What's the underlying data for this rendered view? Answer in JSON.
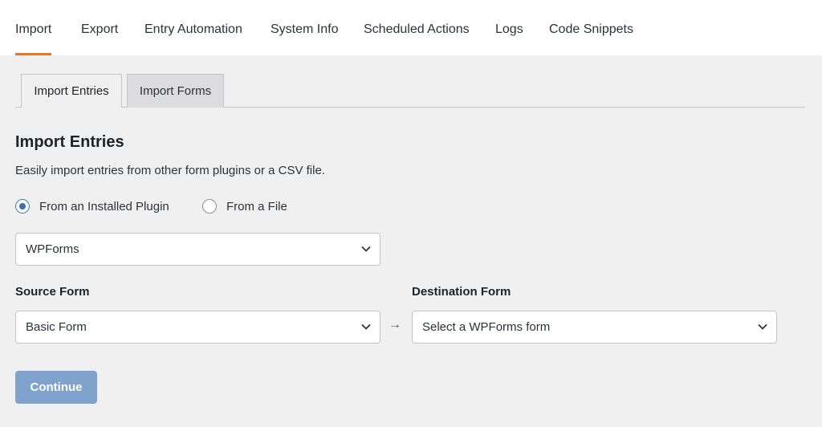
{
  "topnav": {
    "tabs": [
      {
        "label": "Import"
      },
      {
        "label": "Export"
      },
      {
        "label": "Entry Automation"
      },
      {
        "label": "System Info"
      },
      {
        "label": "Scheduled Actions"
      },
      {
        "label": "Logs"
      },
      {
        "label": "Code Snippets"
      }
    ],
    "active": "Import"
  },
  "subtabs": [
    {
      "label": "Import Entries"
    },
    {
      "label": "Import Forms"
    }
  ],
  "section": {
    "title": "Import Entries",
    "description": "Easily import entries from other form plugins or a CSV file."
  },
  "source_type": {
    "options": [
      {
        "label": "From an Installed Plugin",
        "checked": true
      },
      {
        "label": "From a File",
        "checked": false
      }
    ]
  },
  "plugin_select": {
    "value": "WPForms"
  },
  "source_form": {
    "label": "Source Form",
    "value": "Basic Form"
  },
  "arrow": "→",
  "destination_form": {
    "label": "Destination Form",
    "value": "Select a WPForms form"
  },
  "continue_button": {
    "label": "Continue"
  },
  "colors": {
    "accent_underline": "#e27730",
    "radio_checked": "#3f6bb0",
    "button_disabled": "#7fa3cc"
  },
  "icons": {
    "chevron": "chevron-down-icon",
    "radio": "radio-button-icon"
  }
}
